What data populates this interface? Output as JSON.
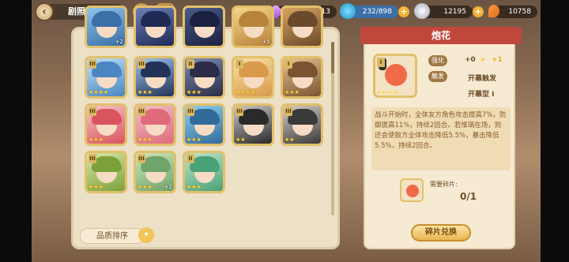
{
  "header": {
    "title": "剧照强化"
  },
  "resources": {
    "gems": "11213",
    "stamina": "232/898",
    "coins": "12195",
    "carrots": "10758"
  },
  "list": {
    "sort_label": "品质排序",
    "cards": [
      {
        "rank": "",
        "stars": "",
        "plus": "+2"
      },
      {
        "rank": "",
        "stars": "",
        "plus": ""
      },
      {
        "rank": "",
        "stars": "",
        "plus": ""
      },
      {
        "rank": "",
        "stars": "",
        "plus": "+5"
      },
      {
        "rank": "",
        "stars": "",
        "plus": ""
      },
      {
        "rank": "III",
        "stars": "★★★★",
        "plus": ""
      },
      {
        "rank": "III",
        "stars": "★★★",
        "plus": ""
      },
      {
        "rank": "II",
        "stars": "★★★",
        "plus": ""
      },
      {
        "rank": "I",
        "stars": "★★★★",
        "plus": ""
      },
      {
        "rank": "I",
        "stars": "★★★",
        "plus": ""
      },
      {
        "rank": "III",
        "stars": "★★★",
        "plus": ""
      },
      {
        "rank": "III",
        "stars": "★★★",
        "plus": ""
      },
      {
        "rank": "III",
        "stars": "★★★",
        "plus": ""
      },
      {
        "rank": "III",
        "stars": "★★",
        "plus": ""
      },
      {
        "rank": "III",
        "stars": "★★",
        "plus": ""
      },
      {
        "rank": "III",
        "stars": "★★★",
        "plus": ""
      },
      {
        "rank": "III",
        "stars": "★★★",
        "plus": "+2"
      },
      {
        "rank": "II",
        "stars": "★★★",
        "plus": ""
      }
    ]
  },
  "detail": {
    "title": "炮花",
    "rank": "I",
    "stars": "★★★★★",
    "enhance_label": "强化",
    "enhance_from": "+0",
    "enhance_to": "+1",
    "trigger_label": "触发",
    "trigger_value": "开幕触发",
    "open_type": "开幕型 I",
    "description": "战斗开始时，全体友方角色攻击提高7%，防御提高11%，持续2回合。若惟璃在场，则还会使敌方全体攻击降低5.5%，暴击降低5.5%，持续2回合。",
    "fragments_label": "需要碎片:",
    "fragments_count": "0/1",
    "exchange_label": "碎片兑换"
  }
}
